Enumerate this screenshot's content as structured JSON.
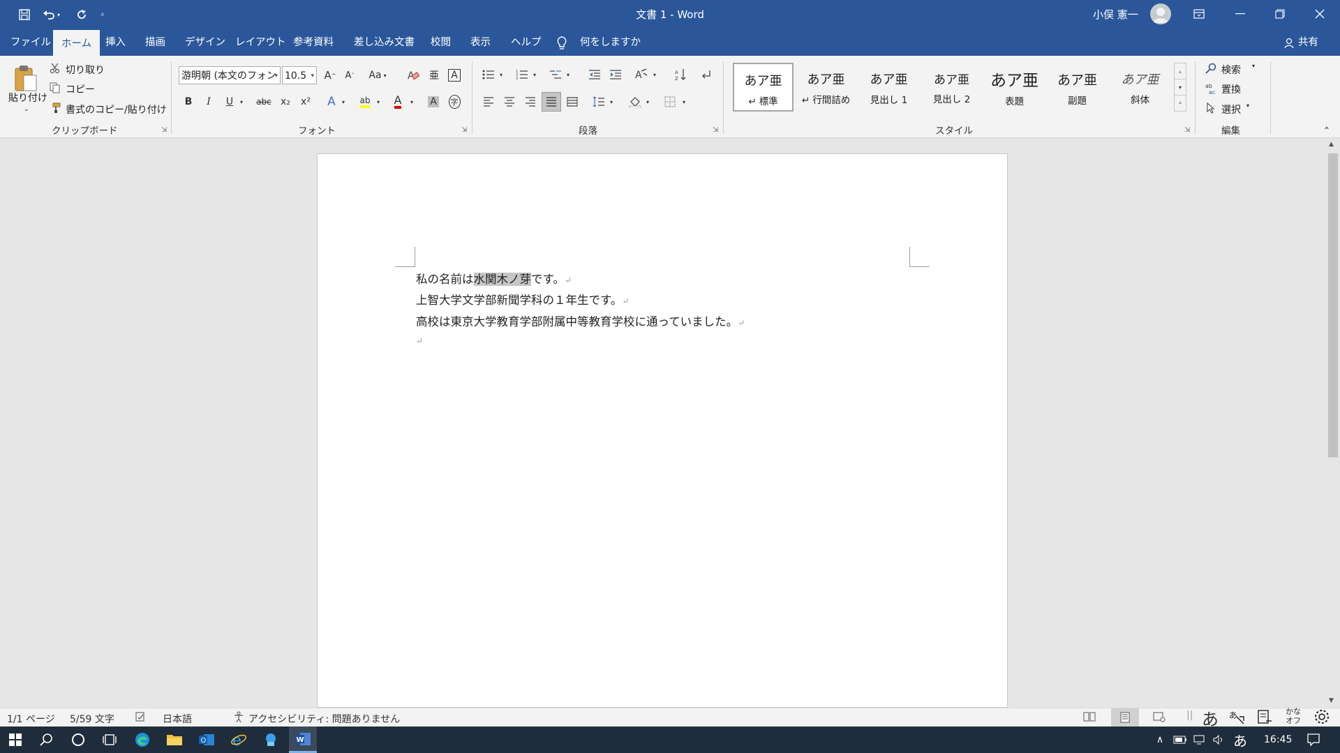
{
  "titlebar": {
    "doc_title": "文書 1  -  Word",
    "user_name": "小俣 憲一"
  },
  "tabs": [
    {
      "label": "ファイル"
    },
    {
      "label": "ホーム"
    },
    {
      "label": "挿入"
    },
    {
      "label": "描画"
    },
    {
      "label": "デザイン"
    },
    {
      "label": "レイアウト"
    },
    {
      "label": "参考資料"
    },
    {
      "label": "差し込み文書"
    },
    {
      "label": "校閲"
    },
    {
      "label": "表示"
    },
    {
      "label": "ヘルプ"
    }
  ],
  "tell_me": "何をしますか",
  "share": "共有",
  "clipboard": {
    "paste": "貼り付け",
    "cut": "切り取り",
    "copy": "コピー",
    "format_painter": "書式のコピー/貼り付け",
    "group": "クリップボード"
  },
  "font": {
    "name": "游明朝 (本文のフォン",
    "size": "10.5",
    "group": "フォント",
    "glyphs": {
      "grow": "A",
      "shrink": "A",
      "case": "Aa",
      "clear": "A",
      "phonetic": "亜",
      "enclose": "A",
      "bold": "B",
      "italic": "I",
      "underline": "U",
      "strike": "abc",
      "sub": "x₂",
      "sup": "x²",
      "effect": "A",
      "highlight": "ab",
      "color": "A",
      "shade": "A",
      "enclosed": "字"
    }
  },
  "paragraph": {
    "group": "段落"
  },
  "styles": {
    "group": "スタイル",
    "items": [
      {
        "sample": "あア亜",
        "name": "↵ 標準"
      },
      {
        "sample": "あア亜",
        "name": "↵ 行間詰め"
      },
      {
        "sample": "あア亜",
        "name": "見出し 1"
      },
      {
        "sample": "あア亜",
        "name": "見出し 2"
      },
      {
        "sample": "あア亜",
        "name": "表題"
      },
      {
        "sample": "あア亜",
        "name": "副題"
      },
      {
        "sample": "あア亜",
        "name": "斜体"
      }
    ]
  },
  "editing": {
    "find": "検索",
    "replace": "置換",
    "select": "選択",
    "group": "編集"
  },
  "document": {
    "line1_pre": "私の名前は",
    "line1_sel": "水関木ノ芽",
    "line1_post": "です。",
    "line2": "上智大学文学部新聞学科の１年生です。",
    "line3": "高校は東京大学教育学部附属中等教育学校に通っていました。",
    "para_mark": "↵"
  },
  "status": {
    "page": "1/1 ページ",
    "words": "5/59 文字",
    "language": "日本語",
    "accessibility": "アクセシビリティ: 問題ありません"
  },
  "ime": {
    "mode": "あ",
    "kana": "かな",
    "kana_off": "オフ"
  },
  "taskbar": {
    "time": "16:45",
    "ime": "あ"
  }
}
